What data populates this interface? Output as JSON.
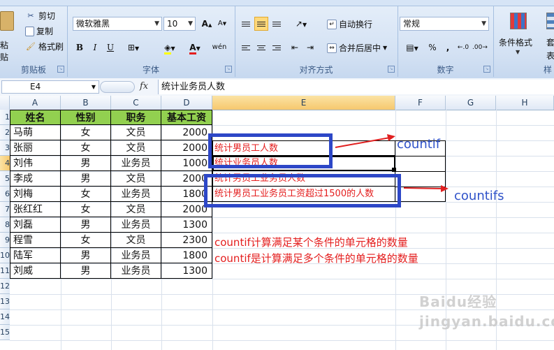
{
  "ribbon": {
    "clipboard": {
      "paste_label": "粘贴",
      "cut_label": "剪切",
      "copy_label": "复制",
      "format_painter_label": "格式刷",
      "group_label": "剪贴板"
    },
    "font": {
      "font_name": "微软雅黑",
      "font_size": "10",
      "grow_glyph": "A",
      "shrink_glyph": "A",
      "bold": "B",
      "italic": "I",
      "underline": "U",
      "phonetic": "wén",
      "group_label": "字体"
    },
    "alignment": {
      "wrap_text_label": "自动换行",
      "merge_center_label": "合并后居中",
      "group_label": "对齐方式"
    },
    "number": {
      "format": "常规",
      "percent": "%",
      "comma": ",",
      "group_label": "数字"
    },
    "styles": {
      "conditional_format_label": "条件格式",
      "table_format_label": "套用表格格式",
      "group_label": "样"
    }
  },
  "formula_bar": {
    "name_box": "E4",
    "fx": "fx",
    "content": "统计业务员人数"
  },
  "columns": [
    "A",
    "B",
    "C",
    "D",
    "E",
    "F",
    "G",
    "H"
  ],
  "selected_column": "E",
  "rows": [
    "1",
    "2",
    "3",
    "4",
    "5",
    "6",
    "7",
    "8",
    "9",
    "10",
    "11",
    "12",
    "13",
    "14",
    "15"
  ],
  "selected_row": "4",
  "table": {
    "headers": [
      "姓名",
      "性别",
      "职务",
      "基本工资"
    ],
    "rows": [
      [
        "马萌",
        "女",
        "文员",
        "2000"
      ],
      [
        "张丽",
        "女",
        "文员",
        "2000"
      ],
      [
        "刘伟",
        "男",
        "业务员",
        "1000"
      ],
      [
        "李成",
        "男",
        "文员",
        "2000"
      ],
      [
        "刘梅",
        "女",
        "业务员",
        "1800"
      ],
      [
        "张红红",
        "女",
        "文员",
        "2000"
      ],
      [
        "刘磊",
        "男",
        "业务员",
        "1300"
      ],
      [
        "程雪",
        "女",
        "文员",
        "2300"
      ],
      [
        "陆军",
        "男",
        "业务员",
        "1800"
      ],
      [
        "刘威",
        "男",
        "业务员",
        "1300"
      ]
    ]
  },
  "e_cells": [
    "统计男员工人数",
    "统计业务员人数",
    "统计男员工业务员人数",
    "统计男员工业务员工资超过1500的人数"
  ],
  "annotations": {
    "countif_label": "countif",
    "countifs_label": "countifs",
    "note1": "countif计算满足某个条件的单元格的数量",
    "note2": "countif是计算满足多个条件的单元格的数量"
  },
  "watermark": "Baidu经验 jingyan.baidu.com",
  "colors": {
    "header_fill": "#92d050",
    "annotation_box": "#2d47c7",
    "arrow": "#e02020",
    "note_text": "#e41e1e",
    "label_blue": "#2f52c9"
  }
}
